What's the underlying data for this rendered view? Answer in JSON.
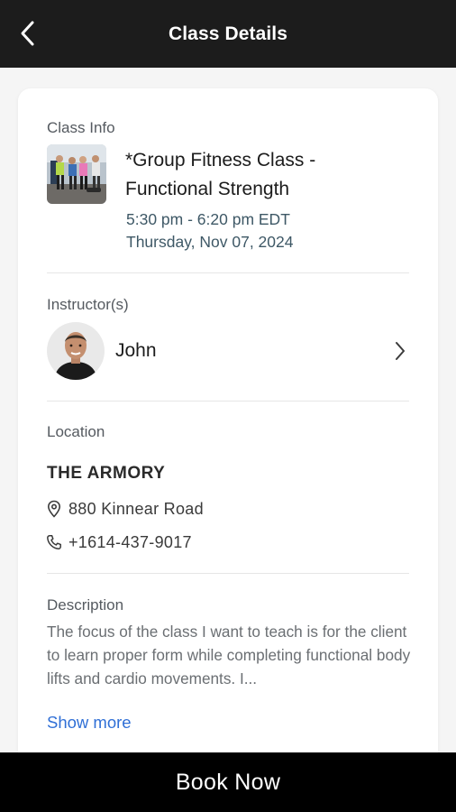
{
  "header": {
    "title": "Class Details",
    "back_icon": "chevron-left-icon"
  },
  "class_info": {
    "label": "Class Info",
    "title": "*Group Fitness Class - Functional Strength",
    "time": "5:30 pm - 6:20 pm EDT",
    "date": "Thursday, Nov 07, 2024"
  },
  "instructor": {
    "label": "Instructor(s)",
    "name": "John",
    "chevron_icon": "chevron-right-icon"
  },
  "location": {
    "label": "Location",
    "name": "THE ARMORY",
    "address": "880 Kinnear Road",
    "phone": "+1614-437-9017",
    "address_icon": "map-pin-icon",
    "phone_icon": "phone-icon"
  },
  "description": {
    "label": "Description",
    "text": "The focus of the class I want to teach is for the client to learn proper form while completing functional body lifts and cardio movements. I...",
    "show_more": "Show more"
  },
  "footer": {
    "book_label": "Book Now"
  },
  "colors": {
    "header_bg": "#1c1c1c",
    "footer_bg": "#000000",
    "link": "#2f6fd6",
    "time_text": "#3e5866"
  }
}
